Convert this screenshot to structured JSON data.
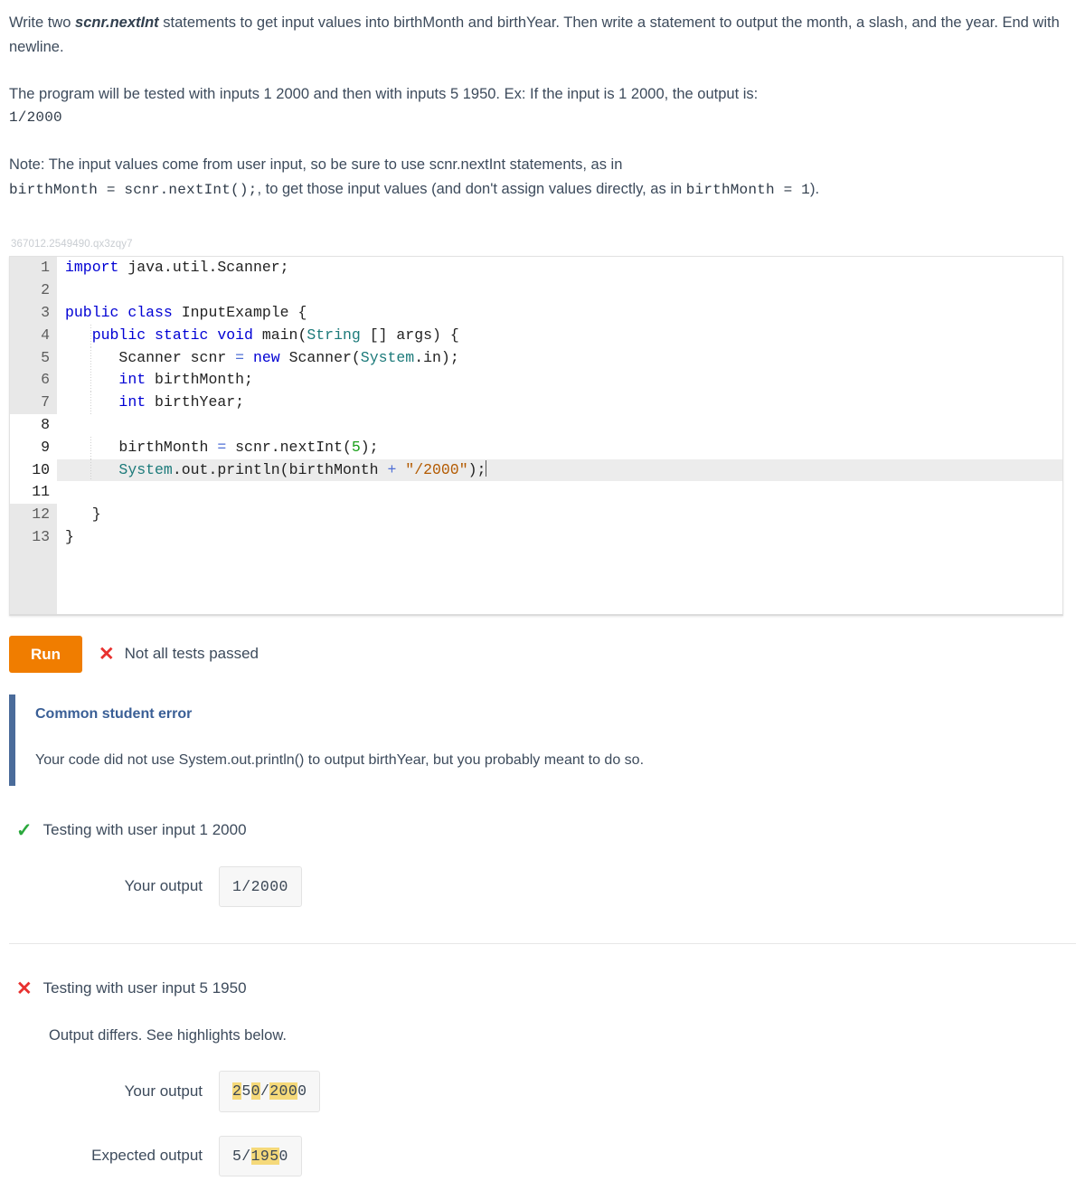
{
  "prompt": {
    "para1_pre": "Write two ",
    "para1_bold": "scnr.nextInt",
    "para1_post": " statements to get input values into birthMonth and birthYear. Then write a statement to output the month, a slash, and the year. End with newline.",
    "para2": "The program will be tested with inputs 1 2000 and then with inputs 5 1950. Ex: If the input is 1 2000, the output is:",
    "example_output": "1/2000",
    "note_line1": "Note: The input values come from user input, so be sure to use scnr.nextInt statements, as in",
    "note_code1": "birthMonth = scnr.nextInt();",
    "note_mid": ", to get those input values (and don't assign values directly, as in ",
    "note_code2": "birthMonth = 1",
    "note_end": ")."
  },
  "editor": {
    "id_label": "367012.2549490.qx3zqy7",
    "lines": [
      {
        "n": "1",
        "editable": false
      },
      {
        "n": "2",
        "editable": false
      },
      {
        "n": "3",
        "editable": false
      },
      {
        "n": "4",
        "editable": false
      },
      {
        "n": "5",
        "editable": false
      },
      {
        "n": "6",
        "editable": false
      },
      {
        "n": "7",
        "editable": false
      },
      {
        "n": "8",
        "editable": true
      },
      {
        "n": "9",
        "editable": true
      },
      {
        "n": "10",
        "editable": true,
        "active": true
      },
      {
        "n": "11",
        "editable": true
      },
      {
        "n": "12",
        "editable": false
      },
      {
        "n": "13",
        "editable": false
      }
    ],
    "code_text": {
      "l1_kw": "import",
      "l1_rest": " java.util.Scanner;",
      "l3_kw1": "public",
      "l3_kw2": "class",
      "l3_name": " InputExample {",
      "l4_kw": "public static void",
      "l4_main": " main(",
      "l4_type": "String",
      "l4_args": " [] args) {",
      "l5_type": "Scanner",
      "l5_var": " scnr ",
      "l5_eq": "=",
      "l5_new": " new",
      "l5_call": " Scanner(",
      "l5_sys": "System",
      "l5_end": ".in);",
      "l6_kw": "int",
      "l6_rest": " birthMonth;",
      "l7_kw": "int",
      "l7_rest": " birthYear;",
      "l9_a": "birthMonth ",
      "l9_eq": "=",
      "l9_b": " scnr.nextInt(",
      "l9_num": "5",
      "l9_c": ");",
      "l10_sys": "System",
      "l10_a": ".out.println(birthMonth ",
      "l10_plus": "+",
      "l10_str": " \"/2000\"",
      "l10_b": ");",
      "l12": "}",
      "l13": "}"
    },
    "colors": {
      "keyword": "#0000d4",
      "type": "#1c7a7a",
      "string": "#b35a00",
      "number": "#1aa01a",
      "operator": "#4f6fd6",
      "gutter_locked": "#e8e8e8",
      "active_line": "#ececec"
    }
  },
  "toolbar": {
    "run_label": "Run",
    "status_icon": "x-icon",
    "status_text": "Not all tests passed",
    "run_color": "#f07d00"
  },
  "error_box": {
    "title": "Common student error",
    "text": "Your code did not use System.out.println() to output birthYear, but you probably meant to do so.",
    "accent_color": "#4a6b9a"
  },
  "tests": [
    {
      "icon": "check-icon",
      "icon_color": "#2aa83c",
      "title": "Testing with user input 1 2000",
      "diff_note": null,
      "rows": [
        {
          "label": "Your output",
          "segments": [
            {
              "t": "1/2000",
              "hl": false
            }
          ]
        }
      ]
    },
    {
      "icon": "x-icon",
      "icon_color": "#e8312f",
      "title": "Testing with user input 5 1950",
      "diff_note": "Output differs. See highlights below.",
      "rows": [
        {
          "label": "Your output",
          "segments": [
            {
              "t": "2",
              "hl": true
            },
            {
              "t": "5",
              "hl": false
            },
            {
              "t": "0",
              "hl": true
            },
            {
              "t": "/",
              "hl": false
            },
            {
              "t": "200",
              "hl": true
            },
            {
              "t": "0",
              "hl": false
            }
          ]
        },
        {
          "label": "Expected output",
          "segments": [
            {
              "t": "5/",
              "hl": false
            },
            {
              "t": "195",
              "hl": true
            },
            {
              "t": "0",
              "hl": false
            }
          ]
        }
      ]
    }
  ],
  "highlight_color": "#f5d97a"
}
